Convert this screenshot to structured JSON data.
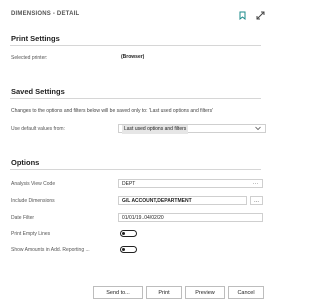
{
  "header": {
    "title": "DIMENSIONS - DETAIL"
  },
  "icons": {
    "bookmark": "bookmark-icon",
    "expand": "expand-icon"
  },
  "print_settings": {
    "title": "Print Settings",
    "selected_printer_label": "Selected printer:",
    "selected_printer_value": "(Browser)"
  },
  "saved_settings": {
    "title": "Saved Settings",
    "note": "Changes to the options and filters below will be saved only to: 'Last used options and filters'",
    "use_default_label": "Use default values from:",
    "use_default_value": "Last used options and filters"
  },
  "options": {
    "title": "Options",
    "analysis_view_code_label": "Analysis View Code",
    "analysis_view_code_value": "DEPT",
    "include_dimensions_label": "Include Dimensions",
    "include_dimensions_value": "G/L ACCOUNT,DEPARTMENT",
    "date_filter_label": "Date Filter",
    "date_filter_value": "01/01/19..04/02/20",
    "print_empty_lines_label": "Print Empty Lines",
    "print_empty_lines_on": false,
    "show_amounts_label": "Show Amounts in Add. Reporting ...",
    "show_amounts_on": false,
    "more_glyph": "..."
  },
  "footer": {
    "send_to": "Send to...",
    "print": "Print",
    "preview": "Preview",
    "cancel": "Cancel"
  }
}
